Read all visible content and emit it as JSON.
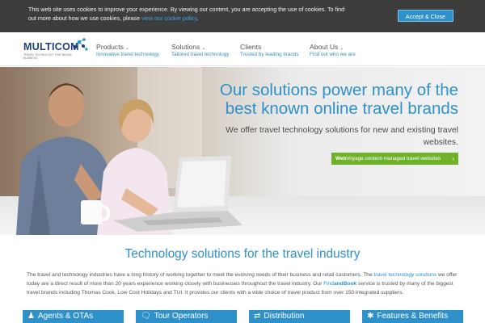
{
  "cookie_bar": {
    "text": "This web site uses cookies to improve your experience. By viewing our content, you are accepting the use of cookies. To find out more about how we use cookies, please",
    "link_text": "view our cookie policy",
    "after_link": ".",
    "accept_label": "Accept & Close"
  },
  "header": {
    "logo_text": "MULTICOM",
    "logo_tagline": "TRAVEL TECHNOLOGY THAT MEANS BUSINESS",
    "nav": [
      {
        "title": "Products",
        "subtitle": "Innovative travel technology",
        "has_dropdown": true
      },
      {
        "title": "Solutions",
        "subtitle": "Tailored travel technology",
        "has_dropdown": true
      },
      {
        "title": "Clients",
        "subtitle": "Trusted by leading brands",
        "has_dropdown": false
      },
      {
        "title": "About Us",
        "subtitle": "Find out who we are",
        "has_dropdown": true
      }
    ]
  },
  "hero": {
    "title": "Our solutions power many of the best known online travel brands",
    "subtitle": "We offer travel technology solutions for new and existing travel websites.",
    "cta_bold": "Web",
    "cta_rest": "Voyage content-managed travel websites",
    "cta_icon": "chevron-right-icon"
  },
  "content": {
    "title": "Technology solutions for the travel industry",
    "p1": "The travel and technology industries have a long history of working together to meet the evolving needs of their business and retail customers. The",
    "p1_link": "travel technology solutions",
    "p2": "we offer today are a direct result of more than 20 years experience working closely with businesses throughout the travel industry. Our",
    "p2_brand_a": "Find",
    "p2_brand_b": "andBook",
    "p3": "service is trusted by many of the biggest travel brands including Thomas Cook, Low Cost Holidays and TUI. It provides our clients with a wide choice of travel product from over 150 integrated suppliers."
  },
  "tiles": [
    {
      "label": "Agents & OTAs",
      "icon": "person-icon"
    },
    {
      "label": "Tour Operators",
      "icon": "chat-icon"
    },
    {
      "label": "Distribution",
      "icon": "distribution-icon"
    },
    {
      "label": "Features & Benefits",
      "icon": "star-icon"
    }
  ],
  "colors": {
    "accent": "#2f91c9",
    "cta_green": "#6fb22a",
    "cookie_bg": "#3d3d3d",
    "logo_navy": "#1d3f7a"
  }
}
